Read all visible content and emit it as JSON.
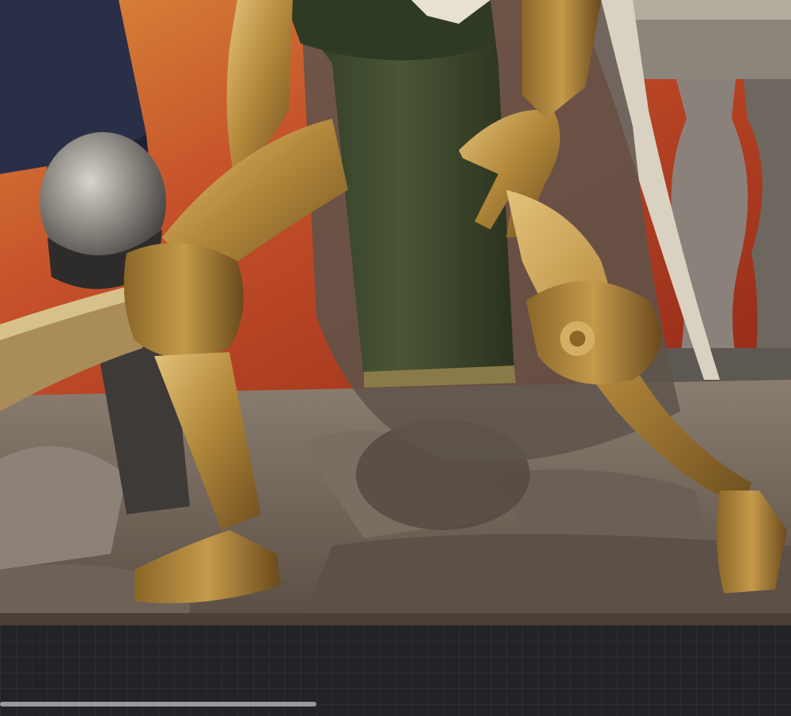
{
  "app": {
    "canvas": {
      "subject": "digital-painting",
      "palette": {
        "background_red": "#b5321c",
        "background_orange": "#d98a3a",
        "armor_gold": "#b58a3c",
        "armor_highlight": "#e3c27a",
        "tabard_green": "#3e4a2c",
        "cloak_white": "#d9d2c2",
        "rubble": "#7a6c5e",
        "shadow": "#3a2f28"
      }
    },
    "workspace": {
      "grid_color": "#2d2e31",
      "background": "#222326"
    },
    "horizontal_scrollbar": {
      "position_fraction": 0.0,
      "visible_fraction": 0.4
    }
  }
}
